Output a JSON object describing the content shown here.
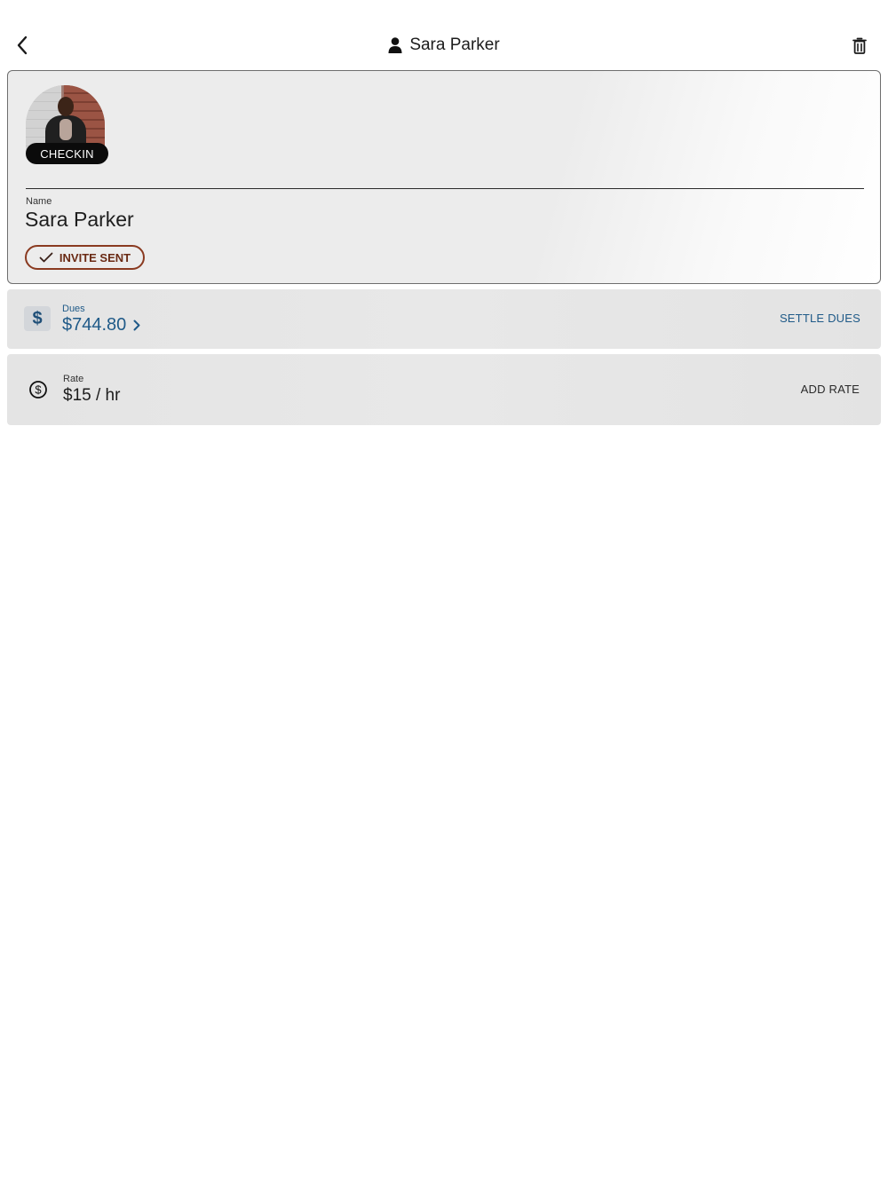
{
  "header": {
    "title": "Sara Parker",
    "back_icon": "chevron-left-icon",
    "user_icon": "person-icon",
    "delete_icon": "trash-icon"
  },
  "profile": {
    "checkin_label": "CHECKIN",
    "name_label": "Name",
    "name_value": "Sara Parker",
    "invite_label": "INVITE SENT",
    "invite_color": "#8a3a20"
  },
  "dues": {
    "label": "Dues",
    "value": "$744.80",
    "icon": "dollar-icon",
    "action": "SETTLE DUES",
    "accent": "#1f5a88"
  },
  "rate": {
    "label": "Rate",
    "value": "$15 / hr",
    "icon": "dollar-circle-icon",
    "action": "ADD RATE"
  }
}
